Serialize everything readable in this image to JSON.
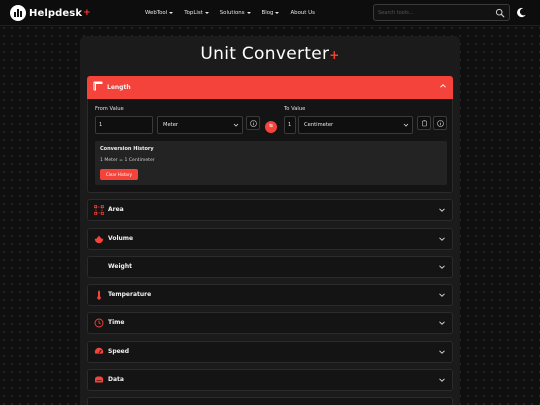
{
  "nav": {
    "brand": "Helpdesk",
    "brand_plus": "+",
    "menu": [
      {
        "label": "WebTool",
        "dropdown": true
      },
      {
        "label": "TopList",
        "dropdown": true
      },
      {
        "label": "Solutions",
        "dropdown": true
      },
      {
        "label": "Blog",
        "dropdown": true
      },
      {
        "label": "About Us",
        "dropdown": false
      }
    ],
    "search_placeholder": "Search tools..."
  },
  "page": {
    "title": "Unit Converter",
    "title_plus": "+"
  },
  "colors": {
    "accent": "#f4433a",
    "background": "#0f0f0f",
    "panel": "#1b1b1b"
  },
  "converter": {
    "active_category": "Length",
    "from_label": "From Value",
    "from_value": "1",
    "from_unit": "Meter",
    "to_label": "To Value",
    "to_value": "1",
    "to_unit": "Centimeter",
    "swap_label": "⇆",
    "history_title": "Conversion History",
    "history_entry": "1 Meter = 1 Centimeter",
    "clear_label": "Clear History"
  },
  "categories": [
    {
      "label": "Area",
      "icon": "area-icon"
    },
    {
      "label": "Volume",
      "icon": "volume-icon"
    },
    {
      "label": "Weight",
      "icon": "weight-icon"
    },
    {
      "label": "Temperature",
      "icon": "thermometer-icon"
    },
    {
      "label": "Time",
      "icon": "clock-icon"
    },
    {
      "label": "Speed",
      "icon": "speedometer-icon"
    },
    {
      "label": "Data",
      "icon": "database-icon"
    }
  ]
}
